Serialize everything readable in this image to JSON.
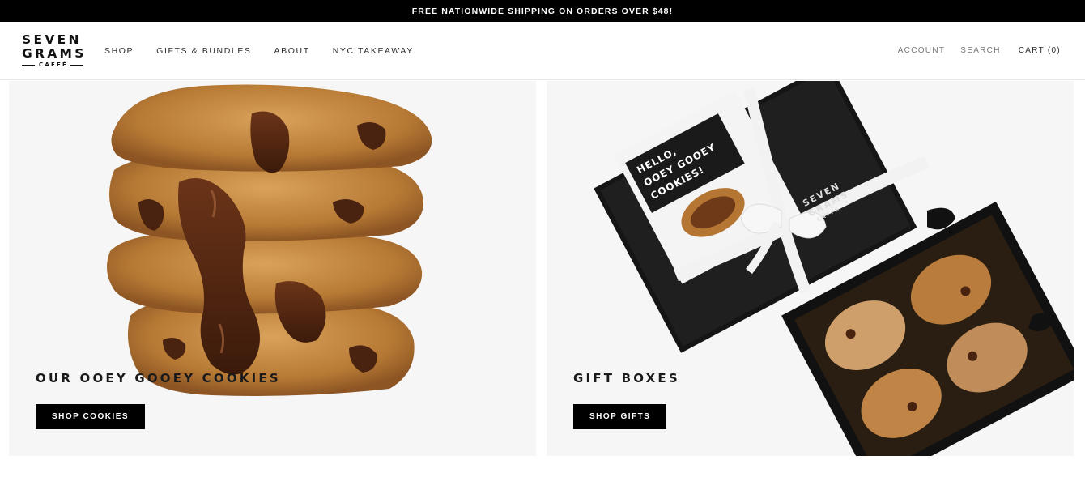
{
  "announcement": {
    "text": "FREE NATIONWIDE SHIPPING ON ORDERS OVER $48!"
  },
  "logo": {
    "line1": "SEVEN",
    "line2": "GRAMS",
    "line3": "CAFFÉ"
  },
  "nav": {
    "primary": [
      "SHOP",
      "GIFTS & BUNDLES",
      "ABOUT",
      "NYC TAKEAWAY"
    ],
    "secondary": {
      "account": "ACCOUNT",
      "search": "SEARCH",
      "cart": "CART (0)"
    }
  },
  "promos": [
    {
      "title": "OUR OOEY GOOEY COOKIES",
      "button": "SHOP COOKIES",
      "image": "stacked-cookies"
    },
    {
      "title": "GIFT BOXES",
      "button": "SHOP GIFTS",
      "image": "gift-box",
      "card_text": [
        "HELLO,",
        "OOEY GOOEY",
        "COOKIES!"
      ],
      "box_logo": [
        "SEVEN",
        "GRAMS",
        "CAFFÉ"
      ]
    }
  ],
  "colors": {
    "announcement_bg": "#000000",
    "button_bg": "#000000",
    "card_bg": "#f6f6f7"
  }
}
